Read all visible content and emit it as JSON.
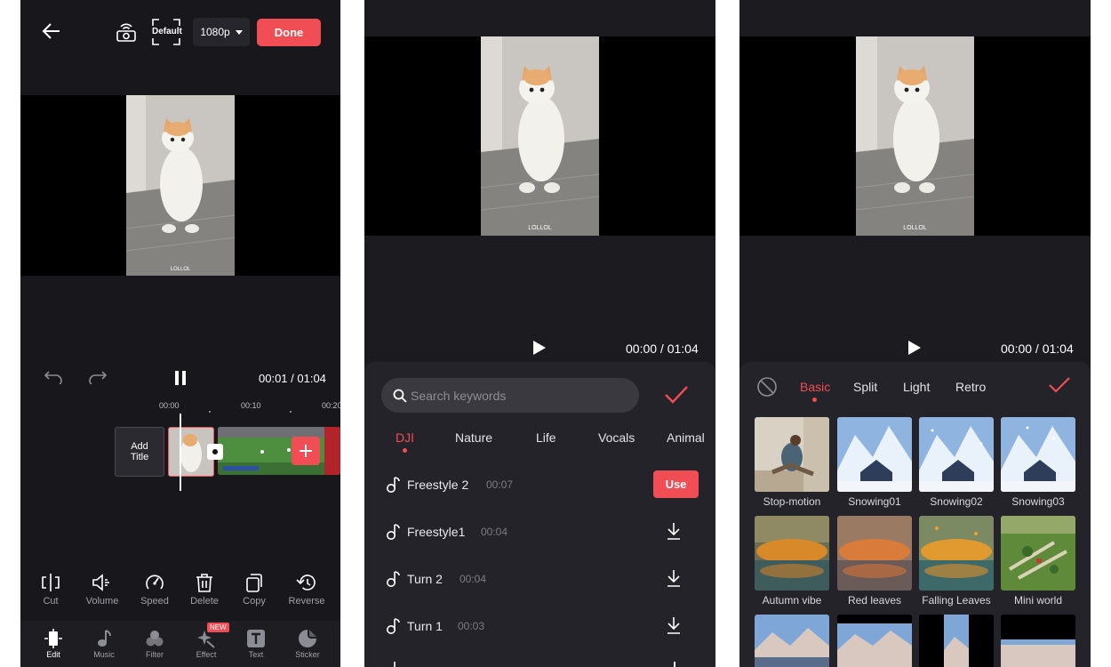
{
  "editor": {
    "quality_label": "Default",
    "resolution": "1080p",
    "done_label": "Done",
    "time": "00:01 / 01:04",
    "ruler": [
      "00:00",
      "00:10",
      "00:20"
    ],
    "add_title": "Add\nTitle",
    "watermark": "LOLLOL",
    "tools": [
      {
        "label": "Cut",
        "icon": "cut-icon"
      },
      {
        "label": "Volume",
        "icon": "volume-icon"
      },
      {
        "label": "Speed",
        "icon": "speed-icon"
      },
      {
        "label": "Delete",
        "icon": "trash-icon"
      },
      {
        "label": "Copy",
        "icon": "copy-icon"
      },
      {
        "label": "Reverse",
        "icon": "reverse-icon"
      }
    ],
    "tabs": [
      {
        "label": "Edit",
        "icon": "edit-icon"
      },
      {
        "label": "Music",
        "icon": "music-icon"
      },
      {
        "label": "Filter",
        "icon": "filter-icon"
      },
      {
        "label": "Effect",
        "icon": "effect-icon",
        "badge": "NEW"
      },
      {
        "label": "Text",
        "icon": "text-icon"
      },
      {
        "label": "Sticker",
        "icon": "sticker-icon"
      }
    ]
  },
  "music": {
    "time": "00:00 / 01:04",
    "search_placeholder": "Search keywords",
    "categories": [
      "DJI",
      "Nature",
      "Life",
      "Vocals",
      "Animal"
    ],
    "tracks": [
      {
        "name": "Freestyle 2",
        "duration": "00:07",
        "action": "Use"
      },
      {
        "name": "Freestyle1",
        "duration": "00:04",
        "action": "download"
      },
      {
        "name": "Turn 2",
        "duration": "00:04",
        "action": "download"
      },
      {
        "name": "Turn 1",
        "duration": "00:03",
        "action": "download"
      }
    ],
    "watermark": "LOLLOL"
  },
  "filters": {
    "time": "00:00 / 01:04",
    "tabs": [
      "Basic",
      "Split",
      "Light",
      "Retro"
    ],
    "items": [
      "Stop-motion",
      "Snowing01",
      "Snowing02",
      "Snowing03",
      "Autumn vibe",
      "Red leaves",
      "Falling Leaves",
      "Mini world"
    ],
    "watermark": "LOLLOL"
  },
  "colors": {
    "accent": "#f04d55",
    "background": "#1c1b20"
  }
}
